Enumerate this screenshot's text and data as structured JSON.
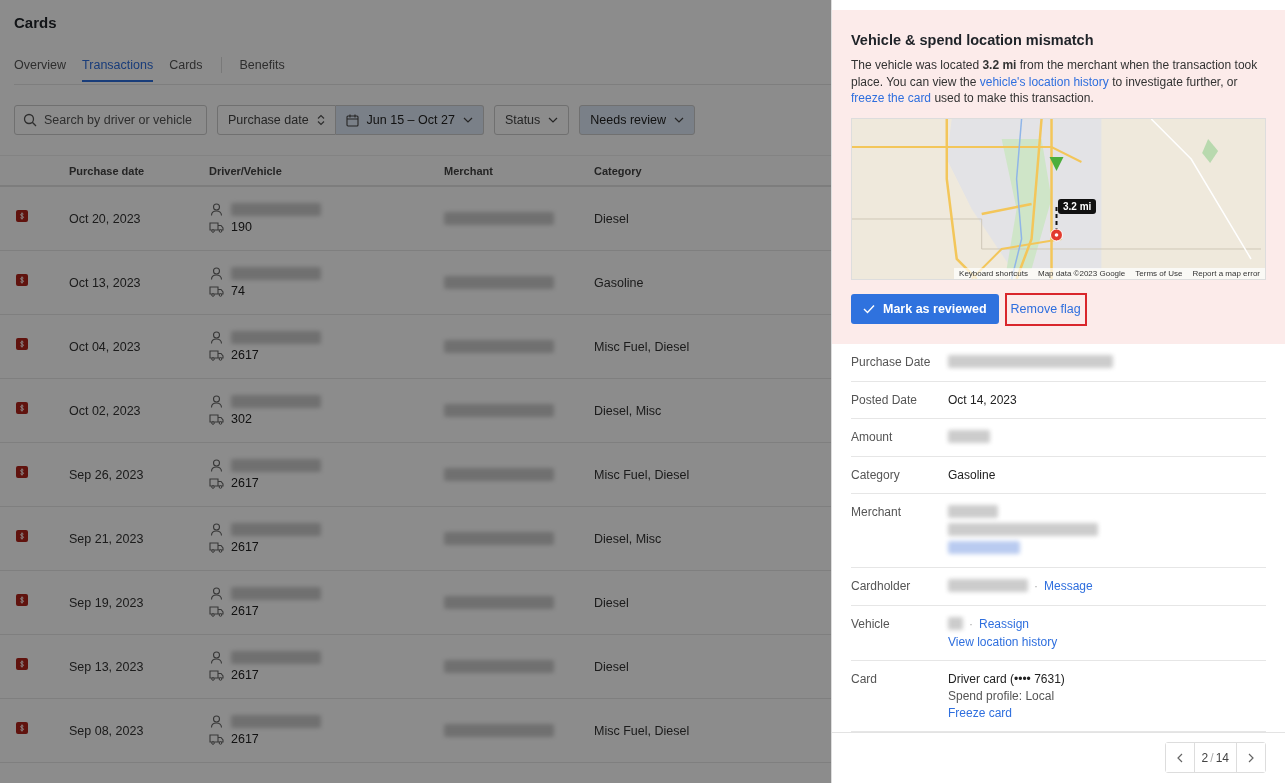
{
  "page": {
    "title": "Cards"
  },
  "tabs": [
    {
      "label": "Overview",
      "selected": false
    },
    {
      "label": "Transactions",
      "selected": true
    },
    {
      "label": "Cards",
      "selected": false
    }
  ],
  "extra_tabs": [
    {
      "label": "Benefits",
      "selected": false
    }
  ],
  "filters": {
    "search": {
      "placeholder": "Search by driver or vehicle"
    },
    "sort": "Purchase date",
    "date_range": "Jun 15 – Oct 27",
    "status": "Status",
    "review": "Needs review"
  },
  "table": {
    "columns": [
      "Purchase date",
      "Driver/Vehicle",
      "Merchant",
      "Category"
    ],
    "rows": [
      {
        "date": "Oct 20, 2023",
        "vehicle": "190",
        "category": "Diesel"
      },
      {
        "date": "Oct 13, 2023",
        "vehicle": "74",
        "category": "Gasoline"
      },
      {
        "date": "Oct 04, 2023",
        "vehicle": "2617",
        "category": "Misc Fuel, Diesel"
      },
      {
        "date": "Oct 02, 2023",
        "vehicle": "302",
        "category": "Diesel, Misc"
      },
      {
        "date": "Sep 26, 2023",
        "vehicle": "2617",
        "category": "Misc Fuel, Diesel"
      },
      {
        "date": "Sep 21, 2023",
        "vehicle": "2617",
        "category": "Diesel, Misc"
      },
      {
        "date": "Sep 19, 2023",
        "vehicle": "2617",
        "category": "Diesel"
      },
      {
        "date": "Sep 13, 2023",
        "vehicle": "2617",
        "category": "Diesel"
      },
      {
        "date": "Sep 08, 2023",
        "vehicle": "2617",
        "category": "Misc Fuel, Diesel"
      }
    ]
  },
  "alert": {
    "title": "Vehicle & spend location mismatch",
    "message": [
      {
        "kind": "text",
        "text": "The vehicle was located "
      },
      {
        "kind": "bold",
        "text": "3.2 mi"
      },
      {
        "kind": "text",
        "text": " from the merchant when the transaction took place. You can view the "
      },
      {
        "kind": "link",
        "text": "vehicle's location history"
      },
      {
        "kind": "text",
        "text": " to investigate further, or "
      },
      {
        "kind": "link",
        "text": "freeze the card"
      },
      {
        "kind": "text",
        "text": " used to make this transaction."
      }
    ],
    "map": {
      "kind": "picture",
      "distance": "3.2 mi",
      "attribution": [
        "Keyboard shortcuts",
        "Map data ©2023 Google",
        "Terms of Use",
        "Report a map error"
      ]
    },
    "primary_action": "Mark as reviewed",
    "secondary_action": {
      "label": "Remove flag",
      "highlighted": true
    }
  },
  "details": [
    {
      "label": "Purchase Date",
      "kind": "redacted"
    },
    {
      "label": "Posted Date",
      "kind": "text",
      "lines": [
        "Oct 14, 2023"
      ]
    },
    {
      "label": "Amount",
      "kind": "redacted_short"
    },
    {
      "label": "Category",
      "kind": "text",
      "lines": [
        "Gasoline"
      ]
    },
    {
      "label": "Merchant",
      "kind": "redacted_block"
    },
    {
      "label": "Cardholder",
      "kind": "redacted",
      "separator": "·",
      "inline_link": "Message"
    },
    {
      "label": "Vehicle",
      "kind": "redacted_short",
      "separator": "·",
      "inline_link": "Reassign",
      "links": [
        "View location history"
      ]
    },
    {
      "label": "Card",
      "kind": "text",
      "lines": [
        "Driver card (•••• 7631)",
        "Spend profile: Local"
      ],
      "links": [
        "Freeze card"
      ]
    }
  ],
  "pager": {
    "current": "2",
    "separator": "/",
    "total": "14"
  }
}
